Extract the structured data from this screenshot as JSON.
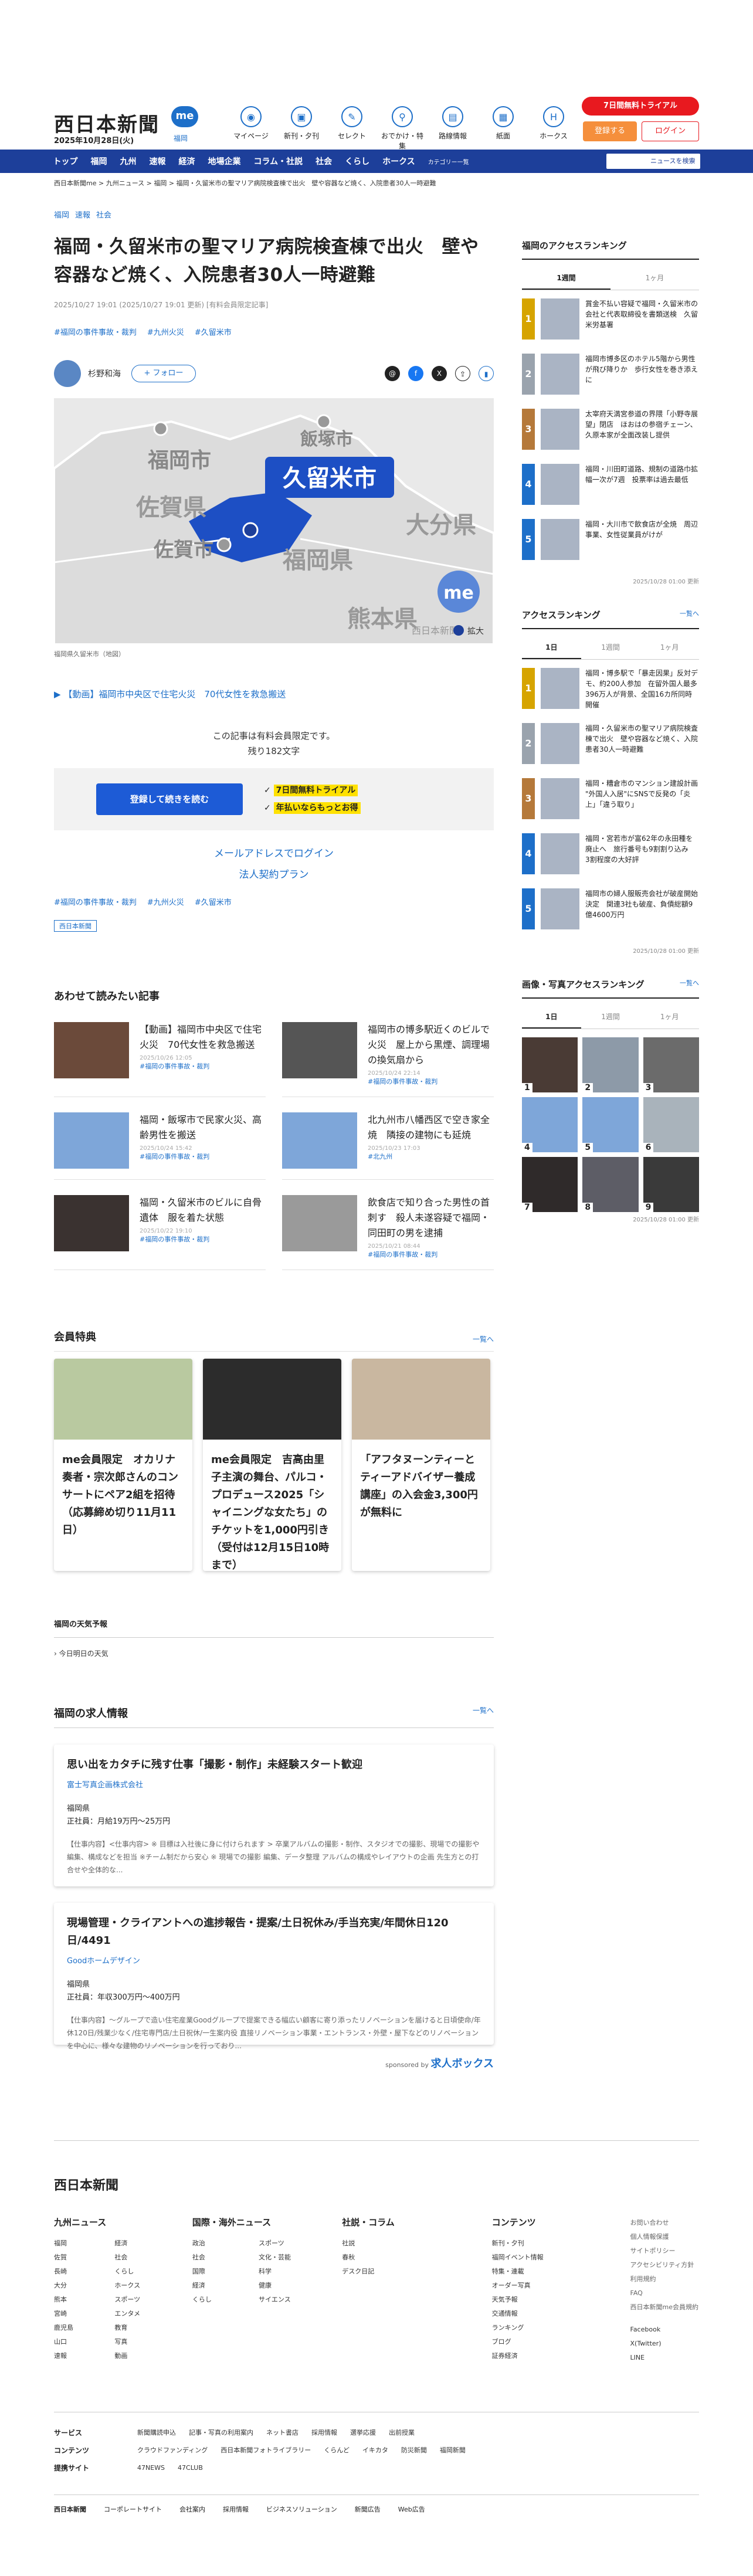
{
  "header": {
    "brand": "西日本新聞",
    "me_logo": "me",
    "date": "2025年10月28日(火)",
    "local": "福岡",
    "nav": [
      {
        "label": "マイページ",
        "icon": "me-icon"
      },
      {
        "label": "新刊・夕刊",
        "icon": "newspaper-icon"
      },
      {
        "label": "セレクト",
        "icon": "select-icon"
      },
      {
        "label": "おでかけ・特集",
        "icon": "walk-icon"
      },
      {
        "label": "路線情報",
        "icon": "train-icon"
      },
      {
        "label": "紙面",
        "icon": "paper-icon"
      },
      {
        "label": "ホークス",
        "icon": "hawks-icon"
      }
    ],
    "trial": "7日間無料トライアル",
    "register": "登録する",
    "login": "ログイン"
  },
  "menubar": {
    "items": [
      "トップ",
      "福岡",
      "九州",
      "速報",
      "経済",
      "地場企業",
      "コラム・社説",
      "社会",
      "くらし",
      "ホークス"
    ],
    "category": "カテゴリー一覧",
    "search_placeholder": "ニュースを検索"
  },
  "breadcrumb": "西日本新聞me > 九州ニュース > 福岡 > 福岡・久留米市の聖マリア病院検査棟で出火　壁や容器など焼く、入院患者30人一時避難",
  "article": {
    "categories": [
      "福岡",
      "速報",
      "社会"
    ],
    "title": "福岡・久留米市の聖マリア病院検査棟で出火　壁や容器など焼く、入院患者30人一時避難",
    "meta": "2025/10/27 19:01 (2025/10/27 19:01 更新) [有料会員限定記事]",
    "tags": [
      "#福岡の事件事故・裁判",
      "#九州火災",
      "#久留米市"
    ],
    "author": "杉野和海",
    "follow": "+ フォロー",
    "map_labels": {
      "fukuoka_city": "福岡市",
      "iizuka": "飯塚市",
      "kurume": "久留米市",
      "saga_pref": "佐賀県",
      "saga_city": "佐賀市",
      "fukuoka_pref": "福岡県",
      "oita": "大分県",
      "kumamoto": "熊本県",
      "credit": "西日本新聞",
      "zoom": "拡大"
    },
    "map_caption": "福岡県久留米市（地図）",
    "related_video": "【動画】福岡市中央区で住宅火災　70代女性を救急搬送",
    "paywall_text": "この記事は有料会員限定です。",
    "paywall_remaining": "残り182文字",
    "paywall_button": "登録して続きを読む",
    "paywall_benefits": [
      "7日間無料トライアル",
      "年払いならもっとお得"
    ],
    "mail_login": "メールアドレスでログイン",
    "corporate": "法人契約プラン",
    "bottom_tags": [
      "#福岡の事件事故・裁判",
      "#九州火災",
      "#久留米市"
    ],
    "badge": "西日本新聞"
  },
  "related": {
    "title": "あわせて読みたい記事",
    "items": [
      {
        "title": "【動画】福岡市中央区で住宅火災　70代女性を救急搬送",
        "date": "2025/10/26 12:05",
        "cat": "#福岡の事件事故・裁判"
      },
      {
        "title": "福岡市の博多駅近くのビルで火災　屋上から黒煙、調理場の換気扇から",
        "date": "2025/10/24 22:14",
        "cat": "#福岡の事件事故・裁判"
      },
      {
        "title": "福岡・飯塚市で民家火災、高齢男性を搬送",
        "date": "2025/10/24 15:42",
        "cat": "#福岡の事件事故・裁判"
      },
      {
        "title": "北九州市八幡西区で空き家全焼　隣接の建物にも延焼",
        "date": "2025/10/23 17:03",
        "cat": "#北九州"
      },
      {
        "title": "福岡・久留米市のビルに自骨遺体　服を着た状態",
        "date": "2025/10/22 19:10",
        "cat": "#福岡の事件事故・裁判"
      },
      {
        "title": "飲食店で知り合った男性の首刺す　殺人未遂容疑で福岡・同田町の男を逮捕",
        "date": "2025/10/21 08:44",
        "cat": "#福岡の事件事故・裁判"
      }
    ]
  },
  "members": {
    "title": "会員特典",
    "more": "一覧へ",
    "cards": [
      "me会員限定　オカリナ奏者・宗次郎さんのコンサートにペア2組を招待（応募締め切り11月11日）",
      "me会員限定　吉高由里子主演の舞台、パルコ・プロデュース2025「シャイニングな女たち」のチケットを1,000円引き（受付は12月15日10時まで）",
      "「アフタヌーンティーとティーアドバイザー養成講座」の入会金3,300円が無料に"
    ]
  },
  "weather": {
    "title": "福岡の天気予報",
    "item": "今日明日の天気"
  },
  "jobs": {
    "title": "福岡の求人情報",
    "more": "一覧へ",
    "items": [
      {
        "title": "思い出をカタチに残す仕事「撮影・制作」未経験スタート歓迎",
        "company": "富士写真企画株式会社",
        "loc": "福岡県",
        "pay": "正社員：月給19万円〜25万円",
        "desc": "【仕事内容】<仕事内容> ※ 目標は入社後に身に付けられます > 卒業アルバムの撮影・制作、スタジオでの撮影、現場での撮影や編集、構成などを担当 ※チーム制だから安心 ※ 現場での撮影 編集、データ整理 アルバムの構成やレイアウトの企画 先生方との打合せや全体的な..."
      },
      {
        "title": "現場管理・クライアントへの進捗報告・提案/土日祝休み/手当充実/年間休日120日/4491",
        "company": "Goodホームデザイン",
        "loc": "福岡県",
        "pay": "正社員：年収300万円〜400万円",
        "desc": "【仕事内容】〜グループで造い住宅産業Goodグループで提案できる幅広い顧客に寄り添ったリノベーションを届けると日頃使命/年休120日/残業少なく/住宅専門店/土日祝休/一生案内役 直接リノベーション事業・エントランス・外壁・屋下などのリノベーションを中心に、様々な建物のリノベーションを行っており..."
      }
    ],
    "sponsored": "sponsored by",
    "sponsor": "求人ボックス"
  },
  "sidebar": {
    "access_title": "福岡のアクセスランキング",
    "tabs1": [
      "1週間",
      "1ヶ月"
    ],
    "ranking1": [
      "賞金不払い容疑で福岡・久留米市の会社と代表取締役を書類送検　久留米労基署",
      "福岡市博多区のホテル5階から男性が飛び降りか　歩行女性を巻き添えに",
      "太宰府天満宮参道の界隈「小野寺展望」閉店　ほおはの参宿チェーン、久原本家が全面改装し提供",
      "福岡・川田町道路、規制の道路巾拡幅一次が7週　投票率は過去最低",
      "福岡・大川市で飲食店が全焼　周辺事業、女性従業員がけが"
    ],
    "update1": "2025/10/28 01:00 更新",
    "access2_title": "アクセスランキング",
    "more": "一覧へ",
    "tabs2": [
      "1日",
      "1週間",
      "1ヶ月"
    ],
    "ranking2": [
      "福岡・博多駅で「暴走因果」反対デモ、約200人参加　在留外国人最多396万人が背景、全国16カ所同時開催",
      "福岡・久留米市の聖マリア病院検査棟で出火　壁や容器など焼く、入院患者30人一時避難",
      "福岡・糟倉市のマンション建設計画 \"外国人入居\"にSNSで反発の「炎上」「違う取り」",
      "福岡・宮若市が富62年の永田種を廃止へ　旅行番号も9割割り込み　3割程度の大好評",
      "福岡市の婦人服販売会社が破産開始決定　関連3社も破産、負債総額9億4600万円"
    ],
    "update2": "2025/10/28 01:00 更新",
    "photo_title": "画像・写真アクセスランキング",
    "tabs3": [
      "1日",
      "1週間",
      "1ヶ月"
    ],
    "update3": "2025/10/28 01:00 更新"
  },
  "footer": {
    "logo": "西日本新聞",
    "cols": [
      {
        "title": "九州ニュース",
        "items": [
          "福岡",
          "佐賀",
          "長崎",
          "大分",
          "熊本",
          "宮崎",
          "鹿児島",
          "山口",
          "速報",
          "経済",
          "社会",
          "くらし",
          "ホークス",
          "スポーツ",
          "エンタメ",
          "教育",
          "写真",
          "動画"
        ]
      },
      {
        "title": "国際・海外ニュース",
        "items": [
          "政治",
          "社会",
          "国際",
          "経済",
          "くらし",
          "スポーツ",
          "文化・芸能",
          "科学",
          "健康",
          "サイエンス"
        ]
      },
      {
        "title": "社説・コラム",
        "items": [
          "社説",
          "春秋",
          "デスク日記"
        ]
      },
      {
        "title": "コンテンツ",
        "items": [
          "新刊・夕刊",
          "福岡イベント情報",
          "特集・連載",
          "オーダー写真",
          "天気予報",
          "交通情報",
          "ランキング",
          "ブログ",
          "証券経済"
        ]
      },
      {
        "title": "",
        "items": [
          "お問い合わせ",
          "個人情報保護",
          "サイトポリシー",
          "アクセシビリティ方針",
          "利用規約",
          "FAQ",
          "西日本新聞me会員規約"
        ]
      }
    ],
    "social": [
      "Facebook",
      "X(Twitter)",
      "LINE"
    ],
    "rows": [
      {
        "title": "サービス",
        "items": [
          "新聞購読申込",
          "記事・写真の利用案内",
          "ネット書店",
          "採用情報",
          "選挙応援",
          "出前授業"
        ]
      },
      {
        "title": "コンテンツ",
        "items": [
          "クラウドファンディング",
          "西日本新聞フォトライブラリー",
          "くらんど",
          "イキカタ",
          "防災新聞",
          "福岡新聞"
        ]
      },
      {
        "title": "提携サイト",
        "items": [
          "47NEWS",
          "47CLUB"
        ]
      }
    ],
    "bottom": [
      "コーポレートサイト",
      "会社案内",
      "採用情報",
      "ビジネスソリューション",
      "新聞広告",
      "Web広告"
    ]
  },
  "colors": {
    "brand": "#1d3f9a",
    "accent": "#e8191f",
    "link": "#1d6fc9",
    "map_kurume": "#1d4fc4"
  }
}
